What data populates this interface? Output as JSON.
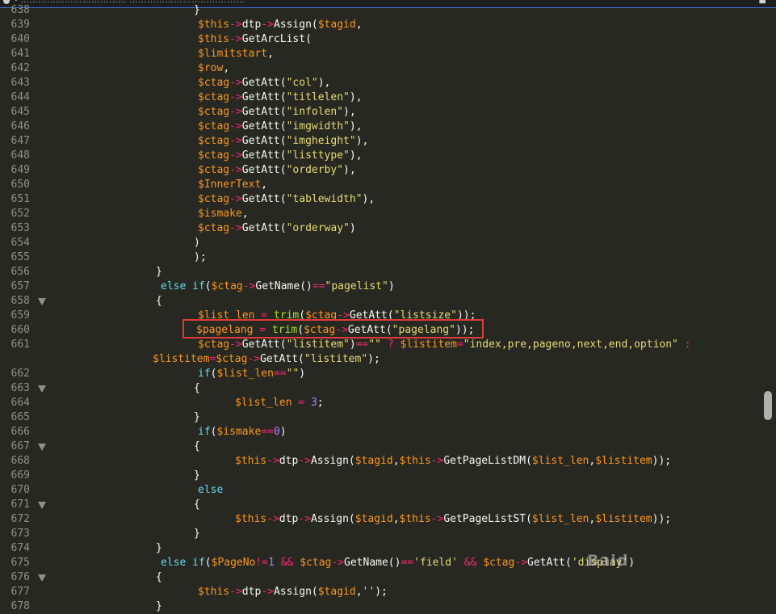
{
  "window": {
    "title": "• ……………………………… …………………………………"
  },
  "editor": {
    "lines": [
      {
        "n": "638",
        "fold": false,
        "indent": 240,
        "t": [
          {
            "c": "p",
            "x": "}"
          }
        ]
      },
      {
        "n": "639",
        "fold": false,
        "indent": 245,
        "t": [
          {
            "c": "v",
            "x": "$this"
          },
          {
            "c": "op",
            "x": "->"
          },
          {
            "c": "p",
            "x": "dtp"
          },
          {
            "c": "op",
            "x": "->"
          },
          {
            "c": "p",
            "x": "Assign("
          },
          {
            "c": "v",
            "x": "$tagid"
          },
          {
            "c": "p",
            "x": ","
          }
        ]
      },
      {
        "n": "640",
        "fold": false,
        "indent": 245,
        "t": [
          {
            "c": "v",
            "x": "$this"
          },
          {
            "c": "op",
            "x": "->"
          },
          {
            "c": "p",
            "x": "GetArcList("
          }
        ]
      },
      {
        "n": "641",
        "fold": false,
        "indent": 245,
        "t": [
          {
            "c": "v",
            "x": "$limitstart"
          },
          {
            "c": "p",
            "x": ","
          }
        ]
      },
      {
        "n": "642",
        "fold": false,
        "indent": 245,
        "t": [
          {
            "c": "v",
            "x": "$row"
          },
          {
            "c": "p",
            "x": ","
          }
        ]
      },
      {
        "n": "643",
        "fold": false,
        "indent": 245,
        "t": [
          {
            "c": "v",
            "x": "$ctag"
          },
          {
            "c": "op",
            "x": "->"
          },
          {
            "c": "p",
            "x": "GetAtt("
          },
          {
            "c": "s",
            "x": "\"col\""
          },
          {
            "c": "p",
            "x": "),"
          }
        ]
      },
      {
        "n": "644",
        "fold": false,
        "indent": 245,
        "t": [
          {
            "c": "v",
            "x": "$ctag"
          },
          {
            "c": "op",
            "x": "->"
          },
          {
            "c": "p",
            "x": "GetAtt("
          },
          {
            "c": "s",
            "x": "\"titlelen\""
          },
          {
            "c": "p",
            "x": "),"
          }
        ]
      },
      {
        "n": "645",
        "fold": false,
        "indent": 245,
        "t": [
          {
            "c": "v",
            "x": "$ctag"
          },
          {
            "c": "op",
            "x": "->"
          },
          {
            "c": "p",
            "x": "GetAtt("
          },
          {
            "c": "s",
            "x": "\"infolen\""
          },
          {
            "c": "p",
            "x": "),"
          }
        ]
      },
      {
        "n": "646",
        "fold": false,
        "indent": 245,
        "t": [
          {
            "c": "v",
            "x": "$ctag"
          },
          {
            "c": "op",
            "x": "->"
          },
          {
            "c": "p",
            "x": "GetAtt("
          },
          {
            "c": "s",
            "x": "\"imgwidth\""
          },
          {
            "c": "p",
            "x": "),"
          }
        ]
      },
      {
        "n": "647",
        "fold": false,
        "indent": 245,
        "t": [
          {
            "c": "v",
            "x": "$ctag"
          },
          {
            "c": "op",
            "x": "->"
          },
          {
            "c": "p",
            "x": "GetAtt("
          },
          {
            "c": "s",
            "x": "\"imgheight\""
          },
          {
            "c": "p",
            "x": "),"
          }
        ]
      },
      {
        "n": "648",
        "fold": false,
        "indent": 245,
        "t": [
          {
            "c": "v",
            "x": "$ctag"
          },
          {
            "c": "op",
            "x": "->"
          },
          {
            "c": "p",
            "x": "GetAtt("
          },
          {
            "c": "s",
            "x": "\"listtype\""
          },
          {
            "c": "p",
            "x": "),"
          }
        ]
      },
      {
        "n": "649",
        "fold": false,
        "indent": 245,
        "t": [
          {
            "c": "v",
            "x": "$ctag"
          },
          {
            "c": "op",
            "x": "->"
          },
          {
            "c": "p",
            "x": "GetAtt("
          },
          {
            "c": "s",
            "x": "\"orderby\""
          },
          {
            "c": "p",
            "x": "),"
          }
        ]
      },
      {
        "n": "650",
        "fold": false,
        "indent": 245,
        "t": [
          {
            "c": "v",
            "x": "$InnerText"
          },
          {
            "c": "p",
            "x": ","
          }
        ]
      },
      {
        "n": "651",
        "fold": false,
        "indent": 245,
        "t": [
          {
            "c": "v",
            "x": "$ctag"
          },
          {
            "c": "op",
            "x": "->"
          },
          {
            "c": "p",
            "x": "GetAtt("
          },
          {
            "c": "s",
            "x": "\"tablewidth\""
          },
          {
            "c": "p",
            "x": "),"
          }
        ]
      },
      {
        "n": "652",
        "fold": false,
        "indent": 245,
        "t": [
          {
            "c": "v",
            "x": "$ismake"
          },
          {
            "c": "p",
            "x": ","
          }
        ]
      },
      {
        "n": "653",
        "fold": false,
        "indent": 245,
        "t": [
          {
            "c": "v",
            "x": "$ctag"
          },
          {
            "c": "op",
            "x": "->"
          },
          {
            "c": "p",
            "x": "GetAtt("
          },
          {
            "c": "s",
            "x": "\"orderway\""
          },
          {
            "c": "p",
            "x": ")"
          }
        ]
      },
      {
        "n": "654",
        "fold": false,
        "indent": 240,
        "t": [
          {
            "c": "p",
            "x": ")"
          }
        ]
      },
      {
        "n": "655",
        "fold": false,
        "indent": 240,
        "t": [
          {
            "c": "p",
            "x": ");"
          }
        ]
      },
      {
        "n": "656",
        "fold": false,
        "indent": 193,
        "t": [
          {
            "c": "p",
            "x": "}"
          }
        ]
      },
      {
        "n": "657",
        "fold": false,
        "indent": 199,
        "t": [
          {
            "c": "kw",
            "x": "else"
          },
          {
            "c": "p",
            "x": " "
          },
          {
            "c": "kw",
            "x": "if"
          },
          {
            "c": "p",
            "x": "("
          },
          {
            "c": "v",
            "x": "$ctag"
          },
          {
            "c": "op",
            "x": "->"
          },
          {
            "c": "p",
            "x": "GetName()"
          },
          {
            "c": "op",
            "x": "=="
          },
          {
            "c": "s",
            "x": "\"pagelist\""
          },
          {
            "c": "p",
            "x": ")"
          }
        ]
      },
      {
        "n": "658",
        "fold": true,
        "indent": 193,
        "t": [
          {
            "c": "p",
            "x": "{"
          }
        ]
      },
      {
        "n": "659",
        "fold": false,
        "indent": 245,
        "t": [
          {
            "c": "v",
            "x": "$list_len"
          },
          {
            "c": "p",
            "x": " "
          },
          {
            "c": "op",
            "x": "="
          },
          {
            "c": "p",
            "x": " "
          },
          {
            "c": "fn",
            "x": "trim"
          },
          {
            "c": "p",
            "x": "("
          },
          {
            "c": "v",
            "x": "$ctag"
          },
          {
            "c": "op",
            "x": "->"
          },
          {
            "c": "p",
            "x": "GetAtt("
          },
          {
            "c": "s",
            "x": "\"listsize\""
          },
          {
            "c": "p",
            "x": "));"
          }
        ]
      },
      {
        "n": "660",
        "fold": false,
        "indent": 243,
        "t": [
          {
            "c": "v",
            "x": "$pagelang"
          },
          {
            "c": "p",
            "x": " "
          },
          {
            "c": "op",
            "x": "="
          },
          {
            "c": "p",
            "x": " "
          },
          {
            "c": "fn",
            "x": "trim"
          },
          {
            "c": "p",
            "x": "("
          },
          {
            "c": "v",
            "x": "$ctag"
          },
          {
            "c": "op",
            "x": "->"
          },
          {
            "c": "p",
            "x": "GetAtt("
          },
          {
            "c": "s",
            "x": "\"pagelang\""
          },
          {
            "c": "p",
            "x": "));"
          }
        ]
      },
      {
        "n": "661",
        "fold": false,
        "indent": 245,
        "t": [
          {
            "c": "v",
            "x": "$ctag"
          },
          {
            "c": "op",
            "x": "->"
          },
          {
            "c": "p",
            "x": "GetAtt("
          },
          {
            "c": "s",
            "x": "\"listitem\""
          },
          {
            "c": "p",
            "x": ")"
          },
          {
            "c": "op",
            "x": "=="
          },
          {
            "c": "s",
            "x": "\"\""
          },
          {
            "c": "p",
            "x": " "
          },
          {
            "c": "op",
            "x": "?"
          },
          {
            "c": "p",
            "x": " "
          },
          {
            "c": "v",
            "x": "$listitem"
          },
          {
            "c": "op",
            "x": "="
          },
          {
            "c": "s",
            "x": "\"index,pre,pageno,next,end,option\""
          },
          {
            "c": "p",
            "x": " "
          },
          {
            "c": "op",
            "x": ":"
          }
        ]
      },
      {
        "n": "",
        "fold": false,
        "indent": 189,
        "t": [
          {
            "c": "v",
            "x": "$listitem"
          },
          {
            "c": "op",
            "x": "="
          },
          {
            "c": "v",
            "x": "$ctag"
          },
          {
            "c": "op",
            "x": "->"
          },
          {
            "c": "p",
            "x": "GetAtt("
          },
          {
            "c": "s",
            "x": "\"listitem\""
          },
          {
            "c": "p",
            "x": ");"
          }
        ]
      },
      {
        "n": "662",
        "fold": false,
        "indent": 245,
        "t": [
          {
            "c": "kw",
            "x": "if"
          },
          {
            "c": "p",
            "x": "("
          },
          {
            "c": "v",
            "x": "$list_len"
          },
          {
            "c": "op",
            "x": "=="
          },
          {
            "c": "s",
            "x": "\"\""
          },
          {
            "c": "p",
            "x": ")"
          }
        ]
      },
      {
        "n": "663",
        "fold": true,
        "indent": 240,
        "t": [
          {
            "c": "p",
            "x": "{"
          }
        ]
      },
      {
        "n": "664",
        "fold": false,
        "indent": 291,
        "t": [
          {
            "c": "v",
            "x": "$list_len"
          },
          {
            "c": "p",
            "x": " "
          },
          {
            "c": "op",
            "x": "="
          },
          {
            "c": "p",
            "x": " "
          },
          {
            "c": "n",
            "x": "3"
          },
          {
            "c": "p",
            "x": ";"
          }
        ]
      },
      {
        "n": "665",
        "fold": false,
        "indent": 240,
        "t": [
          {
            "c": "p",
            "x": "}"
          }
        ]
      },
      {
        "n": "666",
        "fold": false,
        "indent": 245,
        "t": [
          {
            "c": "kw",
            "x": "if"
          },
          {
            "c": "p",
            "x": "("
          },
          {
            "c": "v",
            "x": "$ismake"
          },
          {
            "c": "op",
            "x": "=="
          },
          {
            "c": "n",
            "x": "0"
          },
          {
            "c": "p",
            "x": ")"
          }
        ]
      },
      {
        "n": "667",
        "fold": true,
        "indent": 240,
        "t": [
          {
            "c": "p",
            "x": "{"
          }
        ]
      },
      {
        "n": "668",
        "fold": false,
        "indent": 291,
        "t": [
          {
            "c": "v",
            "x": "$this"
          },
          {
            "c": "op",
            "x": "->"
          },
          {
            "c": "p",
            "x": "dtp"
          },
          {
            "c": "op",
            "x": "->"
          },
          {
            "c": "p",
            "x": "Assign("
          },
          {
            "c": "v",
            "x": "$tagid"
          },
          {
            "c": "p",
            "x": ","
          },
          {
            "c": "v",
            "x": "$this"
          },
          {
            "c": "op",
            "x": "->"
          },
          {
            "c": "p",
            "x": "GetPageListDM("
          },
          {
            "c": "v",
            "x": "$list_len"
          },
          {
            "c": "p",
            "x": ","
          },
          {
            "c": "v",
            "x": "$listitem"
          },
          {
            "c": "p",
            "x": "));"
          }
        ]
      },
      {
        "n": "669",
        "fold": false,
        "indent": 240,
        "t": [
          {
            "c": "p",
            "x": "}"
          }
        ]
      },
      {
        "n": "670",
        "fold": false,
        "indent": 245,
        "t": [
          {
            "c": "kw",
            "x": "else"
          }
        ]
      },
      {
        "n": "671",
        "fold": true,
        "indent": 240,
        "t": [
          {
            "c": "p",
            "x": "{"
          }
        ]
      },
      {
        "n": "672",
        "fold": false,
        "indent": 291,
        "t": [
          {
            "c": "v",
            "x": "$this"
          },
          {
            "c": "op",
            "x": "->"
          },
          {
            "c": "p",
            "x": "dtp"
          },
          {
            "c": "op",
            "x": "->"
          },
          {
            "c": "p",
            "x": "Assign("
          },
          {
            "c": "v",
            "x": "$tagid"
          },
          {
            "c": "p",
            "x": ","
          },
          {
            "c": "v",
            "x": "$this"
          },
          {
            "c": "op",
            "x": "->"
          },
          {
            "c": "p",
            "x": "GetPageListST("
          },
          {
            "c": "v",
            "x": "$list_len"
          },
          {
            "c": "p",
            "x": ","
          },
          {
            "c": "v",
            "x": "$listitem"
          },
          {
            "c": "p",
            "x": "));"
          }
        ]
      },
      {
        "n": "673",
        "fold": false,
        "indent": 240,
        "t": [
          {
            "c": "p",
            "x": "}"
          }
        ]
      },
      {
        "n": "674",
        "fold": false,
        "indent": 193,
        "t": [
          {
            "c": "p",
            "x": "}"
          }
        ]
      },
      {
        "n": "675",
        "fold": false,
        "indent": 199,
        "t": [
          {
            "c": "kw",
            "x": "else"
          },
          {
            "c": "p",
            "x": " "
          },
          {
            "c": "kw",
            "x": "if"
          },
          {
            "c": "p",
            "x": "("
          },
          {
            "c": "v",
            "x": "$PageNo"
          },
          {
            "c": "op",
            "x": "!="
          },
          {
            "c": "n",
            "x": "1"
          },
          {
            "c": "p",
            "x": " "
          },
          {
            "c": "op",
            "x": "&&"
          },
          {
            "c": "p",
            "x": " "
          },
          {
            "c": "v",
            "x": "$ctag"
          },
          {
            "c": "op",
            "x": "->"
          },
          {
            "c": "p",
            "x": "GetName()"
          },
          {
            "c": "op",
            "x": "=="
          },
          {
            "c": "s",
            "x": "'field'"
          },
          {
            "c": "p",
            "x": " "
          },
          {
            "c": "op",
            "x": "&&"
          },
          {
            "c": "p",
            "x": " "
          },
          {
            "c": "v",
            "x": "$ctag"
          },
          {
            "c": "op",
            "x": "->"
          },
          {
            "c": "p",
            "x": "GetAtt("
          },
          {
            "c": "s",
            "x": "'display'"
          },
          {
            "c": "p",
            "x": ")"
          }
        ]
      },
      {
        "n": "676",
        "fold": true,
        "indent": 193,
        "t": [
          {
            "c": "p",
            "x": "{"
          }
        ]
      },
      {
        "n": "677",
        "fold": false,
        "indent": 245,
        "t": [
          {
            "c": "v",
            "x": "$this"
          },
          {
            "c": "op",
            "x": "->"
          },
          {
            "c": "p",
            "x": "dtp"
          },
          {
            "c": "op",
            "x": "->"
          },
          {
            "c": "p",
            "x": "Assign("
          },
          {
            "c": "v",
            "x": "$tagid"
          },
          {
            "c": "p",
            "x": ","
          },
          {
            "c": "s",
            "x": "''"
          },
          {
            "c": "p",
            "x": ");"
          }
        ]
      },
      {
        "n": "678",
        "fold": false,
        "indent": 193,
        "t": [
          {
            "c": "p",
            "x": "}"
          }
        ]
      }
    ]
  },
  "watermark": "Baidu"
}
